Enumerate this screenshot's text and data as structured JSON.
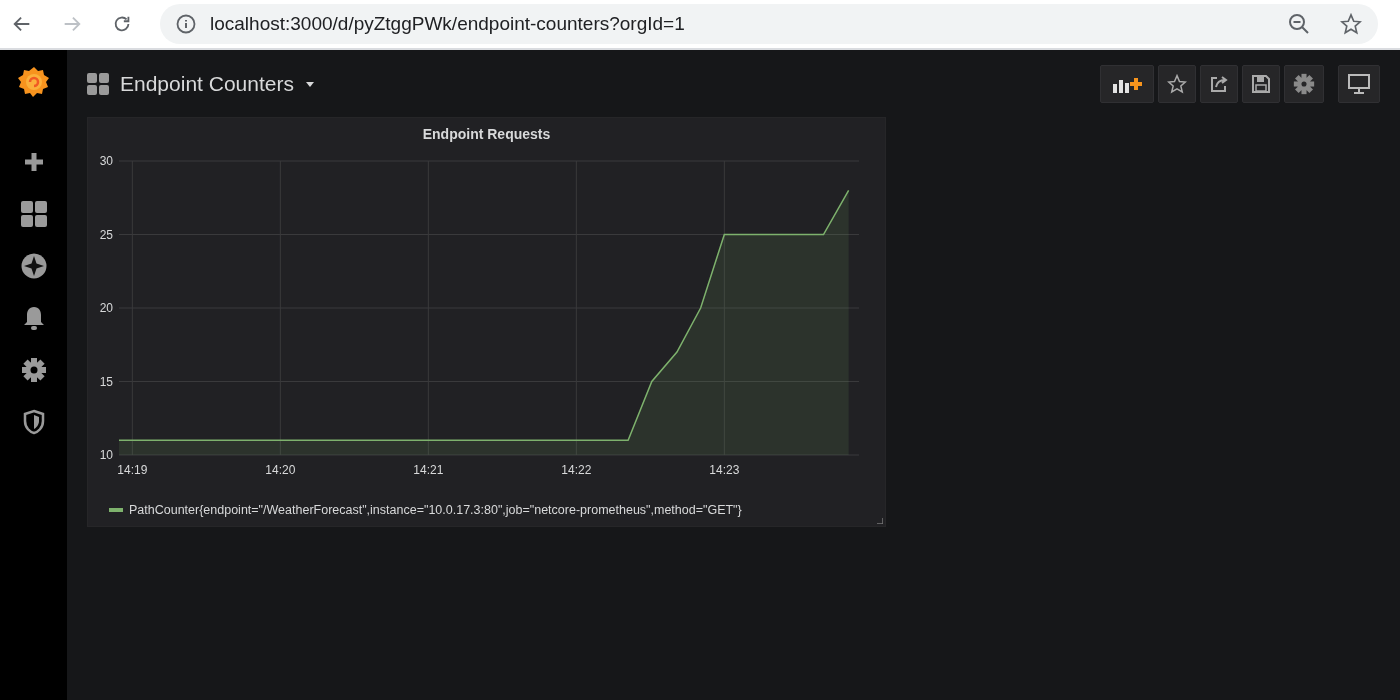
{
  "browser": {
    "url": "localhost:3000/d/pyZtggPWk/endpoint-counters?orgId=1"
  },
  "dashboard": {
    "title": "Endpoint Counters"
  },
  "panel": {
    "title": "Endpoint Requests",
    "chart_data": {
      "type": "area",
      "x": [
        858.91,
        862.35,
        862.51,
        862.68,
        862.84,
        863,
        863.67,
        863.84
      ],
      "series": [
        {
          "name": "PathCounter{endpoint=\"/WeatherForecast\",instance=\"10.0.17.3:80\",job=\"netcore-prometheus\",method=\"GET\"}",
          "color": "#7eb26d",
          "values": [
            11,
            11,
            15,
            17,
            20,
            25,
            25,
            28
          ]
        }
      ],
      "xlim": [
        858.91,
        863.91
      ],
      "ylim": [
        10,
        30
      ],
      "xticks": [
        {
          "value": 859,
          "label": "14:19"
        },
        {
          "value": 860,
          "label": "14:20"
        },
        {
          "value": 861,
          "label": "14:21"
        },
        {
          "value": 862,
          "label": "14:22"
        },
        {
          "value": 863,
          "label": "14:23"
        }
      ],
      "yticks": [
        10,
        15,
        20,
        25,
        30
      ],
      "grid": true
    }
  }
}
